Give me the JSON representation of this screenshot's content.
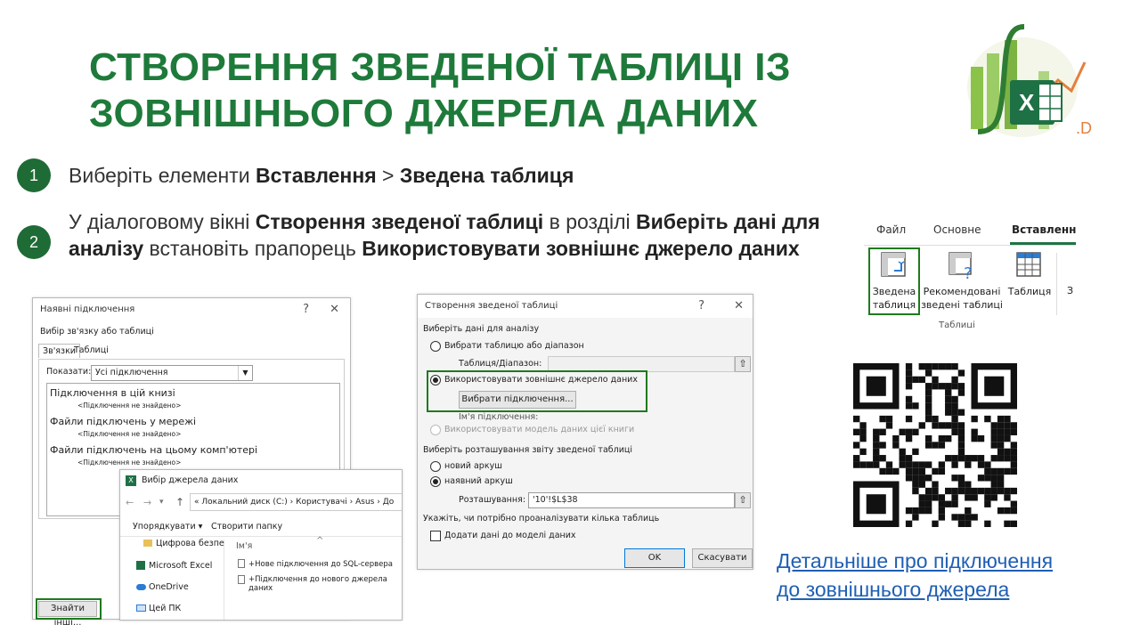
{
  "title": {
    "line1": "СТВОРЕННЯ ЗВЕДЕНОЇ ТАБЛИЦІ ІЗ",
    "line2": "ЗОВНІШНЬОГО ДЖЕРЕЛА ДАНИХ"
  },
  "steps": [
    {
      "num": "1",
      "t1": "Виберіть елементи ",
      "b1": "Вставлення",
      "t2": " > ",
      "b2": "Зведена таблиця"
    },
    {
      "num": "2",
      "t1": "У діалоговому вікні ",
      "b1": "Створення зведеної таблиці",
      "t2": " в розділі ",
      "b2": "Виберіть дані для аналізу",
      "t3": " встановіть прапорець ",
      "b3": "Використовувати зовнішнє джерело даних"
    }
  ],
  "ribbon": {
    "tabs": [
      "Файл",
      "Основне",
      "Вставлення"
    ],
    "pivot_label": "Зведена таблиця",
    "recommended_label": "Рекомендовані зведені таблиці",
    "table_label": "Таблиця",
    "cut_label": "З",
    "group_label": "Таблиці"
  },
  "connections_dialog": {
    "title": "Наявні підключення",
    "help": "?",
    "close": "✕",
    "choose_label": "Вибір зв'язку або таблиці",
    "tab_links": "Зв'язки",
    "tab_tables": "Таблиці",
    "show_label": "Показати:",
    "show_value": "Усі підключення",
    "groups": [
      {
        "title": "Підключення в цій книзі",
        "empty": "<Підключення не знайдено>"
      },
      {
        "title": "Файли підключень у мережі",
        "empty": "<Підключення не знайдено>"
      },
      {
        "title": "Файли підключень на цьому комп'ютері",
        "empty": "<Підключення не знайдено>"
      }
    ],
    "find_more": "Знайти інші..."
  },
  "source_dialog": {
    "title": "Вибір джерела даних",
    "path": [
      "«",
      "Локальний диск (C:)",
      "›",
      "Користувачі",
      "›",
      "Asus",
      "›",
      "До"
    ],
    "organize": "Упорядкувати ▾",
    "new_folder": "Створити папку",
    "column_name": "Ім'я",
    "nav": [
      "Цифрова безпе",
      "Microsoft Excel",
      "OneDrive",
      "Цей ПК"
    ],
    "files": [
      "+Нове підключення до SQL-сервера",
      "+Підключення до нового джерела даних"
    ]
  },
  "pivot_dialog": {
    "title": "Створення зведеної таблиці",
    "help": "?",
    "close": "✕",
    "section1": "Виберіть дані для аналізу",
    "opt_table": "Вибрати таблицю або діапазон",
    "range_label": "Таблиця/Діапазон:",
    "opt_external": "Використовувати зовнішнє джерело даних",
    "choose_conn": "Вибрати підключення...",
    "conn_name": "Ім'я підключення:",
    "opt_model": "Використовувати модель даних цієї книги",
    "section2": "Виберіть розташування звіту зведеної таблиці",
    "opt_new": "новий аркуш",
    "opt_existing": "наявний аркуш",
    "location_label": "Розташування:",
    "location_value": "'10'!$L$38",
    "section3": "Укажіть, чи потрібно проаналізувати кілька таблиць",
    "add_model": "Додати дані до моделі даних",
    "ok": "OK",
    "cancel": "Скасувати"
  },
  "more_link": {
    "line1": "Детальніше про підключення",
    "line2": "до зовнішнього джерела"
  },
  "colors": {
    "title_green": "#1e7a3a",
    "step_circle": "#1e6b36",
    "highlight": "#1e7a1e",
    "link": "#1f5fb4"
  }
}
